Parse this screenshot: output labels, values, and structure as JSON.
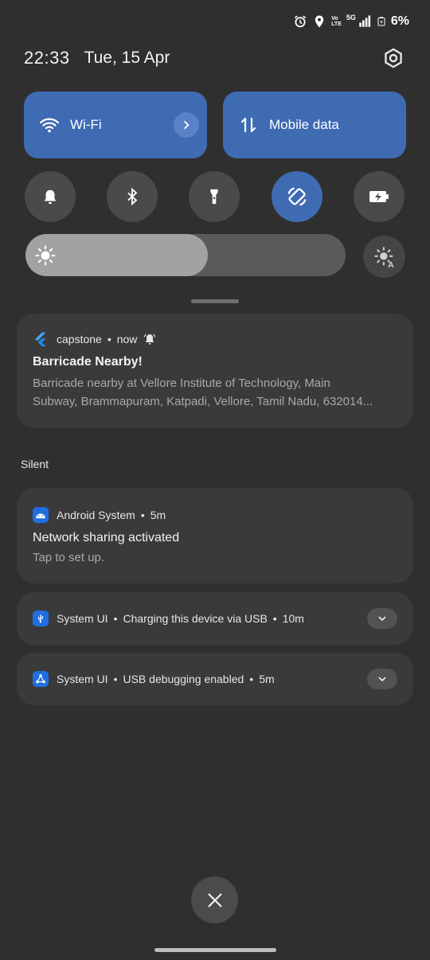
{
  "status_bar": {
    "battery": "6%",
    "network": "5G",
    "volte_top": "Vo",
    "volte_bottom": "LTE",
    "icons": [
      "alarm-icon",
      "location-icon",
      "volte-icon",
      "signal-icon",
      "battery-icon"
    ]
  },
  "header": {
    "time": "22:33",
    "date": "Tue, 15 Apr",
    "settings_icon": "gear-icon"
  },
  "quick_settings": {
    "tiles": [
      {
        "label": "Wi-Fi",
        "icon": "wifi-icon",
        "active": true,
        "has_chevron": true
      },
      {
        "label": "Mobile data",
        "icon": "mobile-data-icon",
        "active": true
      }
    ],
    "toggles": [
      {
        "name": "sound",
        "icon": "bell-icon",
        "active": false
      },
      {
        "name": "bluetooth",
        "icon": "bluetooth-icon",
        "active": false
      },
      {
        "name": "flashlight",
        "icon": "flashlight-icon",
        "active": false
      },
      {
        "name": "auto-rotate",
        "icon": "rotate-icon",
        "active": true
      },
      {
        "name": "battery-saver",
        "icon": "battery-saver-icon",
        "active": false
      }
    ],
    "brightness": {
      "level": 0.57,
      "icon": "brightness-icon",
      "auto_icon": "auto-brightness-icon"
    }
  },
  "notifications": {
    "main": {
      "app": "capstone",
      "time": "now",
      "title": "Barricade Nearby!",
      "body_line1": "Barricade nearby at Vellore Institute of Technology, Main",
      "body_line2": "Subway, Brammapuram, Katpadi, Vellore, Tamil Nadu, 632014..."
    },
    "section_label": "Silent",
    "android": {
      "app": "Android System",
      "time": "5m",
      "title": "Network sharing activated",
      "body": "Tap to set up."
    },
    "usb": {
      "app": "System UI",
      "text": "Charging this device via USB",
      "time": "10m"
    },
    "debug": {
      "app": "System UI",
      "text": "USB debugging enabled",
      "time": "5m"
    },
    "separator": "•"
  },
  "colors": {
    "background": "#2f2f2f",
    "accent": "#3f6bb3",
    "card": "#3a3a3a",
    "toggle_off": "#4a4a4a",
    "app_icon_blue": "#1f6fe0"
  }
}
